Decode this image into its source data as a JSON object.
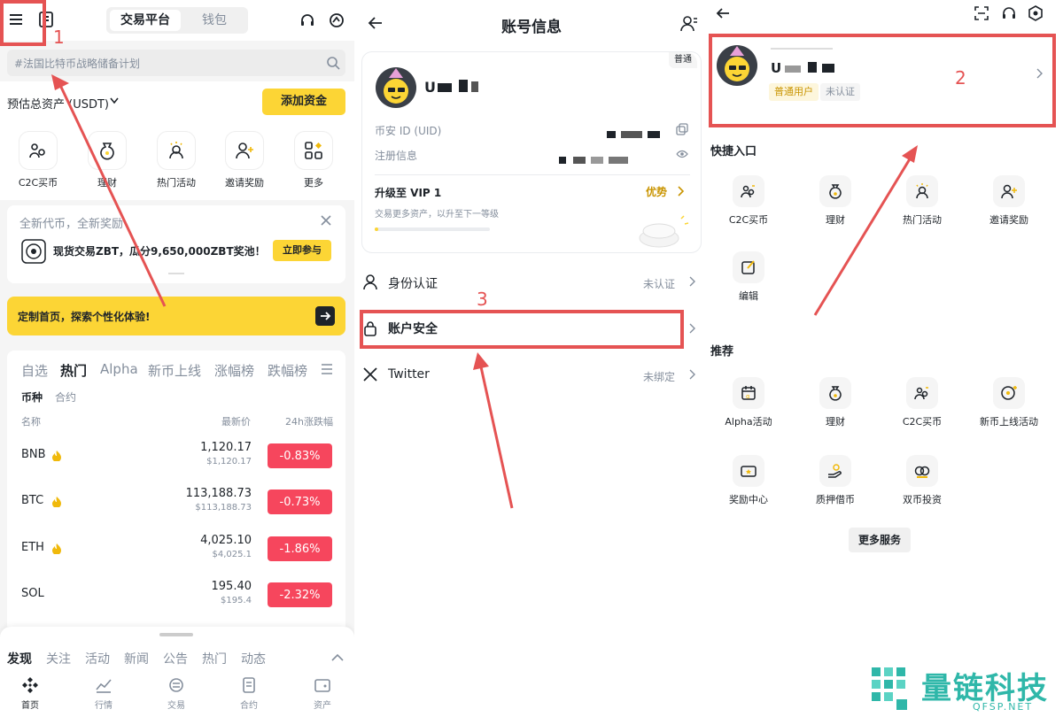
{
  "panel1": {
    "nav_tabs": [
      "交易平台",
      "钱包"
    ],
    "search_placeholder": "#法国比特币战略储备计划",
    "asset_label": "预估总资产 (USDT)",
    "deposit_button": "添加资金",
    "quick_tiles": [
      "C2C买币",
      "理财",
      "热门活动",
      "邀请奖励",
      "更多"
    ],
    "promo": {
      "header": "全新代币，全新奖励",
      "text": "现货交易ZBT，瓜分9,650,000ZBT奖池！",
      "button": "立即参与"
    },
    "custom_banner": "定制首页，探索个性化体验!",
    "market_tabs": [
      "自选",
      "热门",
      "Alpha",
      "新币上线",
      "涨幅榜",
      "跌幅榜"
    ],
    "sub_tabs": [
      "币种",
      "合约"
    ],
    "columns": [
      "名称",
      "最新价",
      "24h涨跌幅"
    ],
    "coins": [
      {
        "symbol": "BNB",
        "price": "1,120.17",
        "usd": "$1,120.17",
        "change": "-0.83%"
      },
      {
        "symbol": "BTC",
        "price": "113,188.73",
        "usd": "$113,188.73",
        "change": "-0.73%"
      },
      {
        "symbol": "ETH",
        "price": "4,025.10",
        "usd": "$4,025.1",
        "change": "-1.86%"
      },
      {
        "symbol": "SOL",
        "price": "195.40",
        "usd": "$195.4",
        "change": "-2.32%"
      }
    ],
    "bottom_tabs": [
      "发现",
      "关注",
      "活动",
      "新闻",
      "公告",
      "热门",
      "动态"
    ],
    "bottom_nav": [
      "首页",
      "行情",
      "交易",
      "合约",
      "资产"
    ],
    "annotation": "1"
  },
  "panel2": {
    "title": "账号信息",
    "username": "U",
    "level_badge": "普通",
    "uid_label": "币安 ID (UID)",
    "register_label": "注册信息",
    "vip_title": "升级至 VIP 1",
    "vip_sub": "交易更多资产，以升至下一等级",
    "vip_link": "优势",
    "menu": [
      {
        "label": "身份认证",
        "value": "未认证"
      },
      {
        "label": "账户安全",
        "value": ""
      },
      {
        "label": "Twitter",
        "value": "未绑定"
      }
    ],
    "annotation": "3"
  },
  "panel3": {
    "username": "U",
    "tag_user": "普通用户",
    "tag_verify": "未认证",
    "quick_title": "快捷入口",
    "quick_items": [
      "C2C买币",
      "理财",
      "热门活动",
      "邀请奖励",
      "编辑"
    ],
    "recommend_title": "推荐",
    "recommend_items": [
      "Alpha活动",
      "理财",
      "C2C买币",
      "新币上线活动",
      "奖励中心",
      "质押借币",
      "双币投资"
    ],
    "more_button": "更多服务",
    "annotation": "2"
  },
  "watermark": {
    "name": "量链科技",
    "domain": "QFSP.NET"
  },
  "colors": {
    "brand_yellow": "#fcd535",
    "down_red": "#f6465d",
    "annotation_red": "#e55353",
    "watermark_teal": "#2fb7a9"
  }
}
